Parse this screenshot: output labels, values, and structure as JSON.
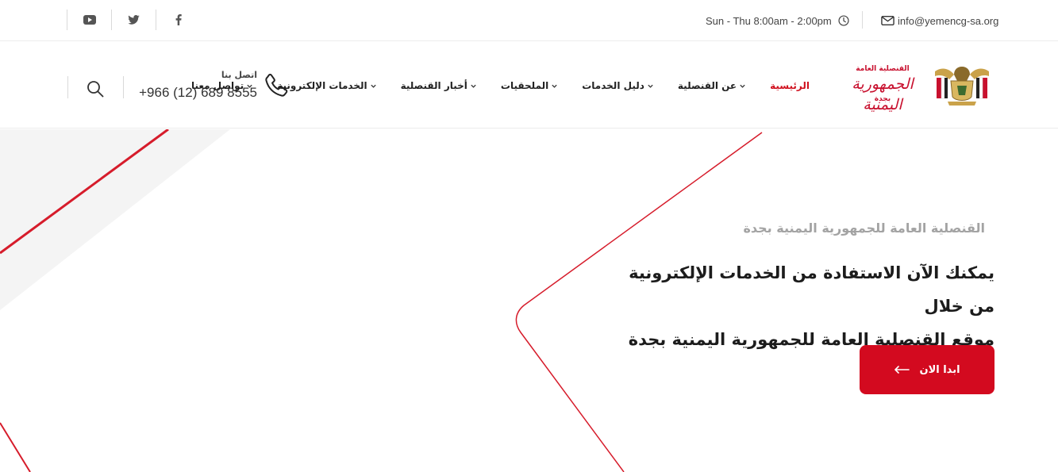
{
  "topbar": {
    "social": [
      {
        "name": "youtube-icon"
      },
      {
        "name": "twitter-icon"
      },
      {
        "name": "facebook-icon"
      }
    ],
    "hours": "Sun - Thu 8:00am - 2:00pm",
    "email": "info@yemencg-sa.org"
  },
  "header": {
    "contact_label": "اتصل بنا",
    "contact_phone": "+966 (12) 689 8555",
    "logo": {
      "line1": "القنصلية العامة",
      "line2": "الجمهورية اليمنية",
      "line3": "بجدة"
    },
    "nav": [
      {
        "label": "الرئيسية",
        "active": true,
        "dropdown": false
      },
      {
        "label": "عن القنصلية",
        "active": false,
        "dropdown": true
      },
      {
        "label": "دليل الخدمات",
        "active": false,
        "dropdown": true
      },
      {
        "label": "الملحقيات",
        "active": false,
        "dropdown": true
      },
      {
        "label": "أخبار القنصلية",
        "active": false,
        "dropdown": true
      },
      {
        "label": "الخدمات الإلكترونية",
        "active": false,
        "dropdown": true
      },
      {
        "label": "تواصل معنا",
        "active": false,
        "dropdown": true
      }
    ]
  },
  "hero": {
    "subtitle": "القنصلية العامة للجمهورية اليمنية بجدة",
    "title_line1": "يمكنك الآن الاستفادة من الخدمات الإلكترونية من خلال",
    "title_line2": "موقع القنصلية العامة للجمهورية اليمنية بجدة",
    "cta_label": "ابدا الان"
  },
  "colors": {
    "accent": "#d30a1f",
    "text": "#222222",
    "muted": "#a3a3a3"
  }
}
